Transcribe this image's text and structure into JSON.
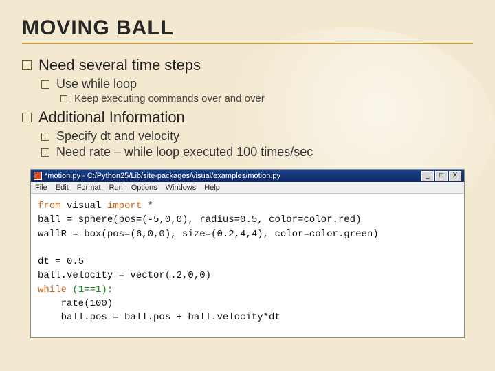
{
  "title": "MOVING BALL",
  "bullets": {
    "need": "Need several time steps",
    "use_while": "Use while loop",
    "keep_exec": "Keep executing commands over and over",
    "additional": "Additional Information",
    "specify_dt": "Specify dt and velocity",
    "need_rate": "Need rate – while loop executed 100 times/sec"
  },
  "editor": {
    "titlebar": "*motion.py - C:/Python25/Lib/site-packages/visual/examples/motion.py",
    "menus": [
      "File",
      "Edit",
      "Format",
      "Run",
      "Options",
      "Windows",
      "Help"
    ],
    "btn_min": "_",
    "btn_max": "□",
    "btn_close": "X"
  },
  "code": {
    "l1a": "from",
    "l1b": " visual ",
    "l1c": "import",
    "l1d": " *",
    "l2": "ball = sphere(pos=(-5,0,0), radius=0.5, color=color.red)",
    "l3": "wallR = box(pos=(6,0,0), size=(0.2,4,4), color=color.green)",
    "l4": "",
    "l5": "dt = 0.5",
    "l6": "ball.velocity = vector(.2,0,0)",
    "l7a": "while",
    "l7b": " (1==1):",
    "l8": "    rate(100)",
    "l9": "    ball.pos = ball.pos + ball.velocity*dt"
  }
}
